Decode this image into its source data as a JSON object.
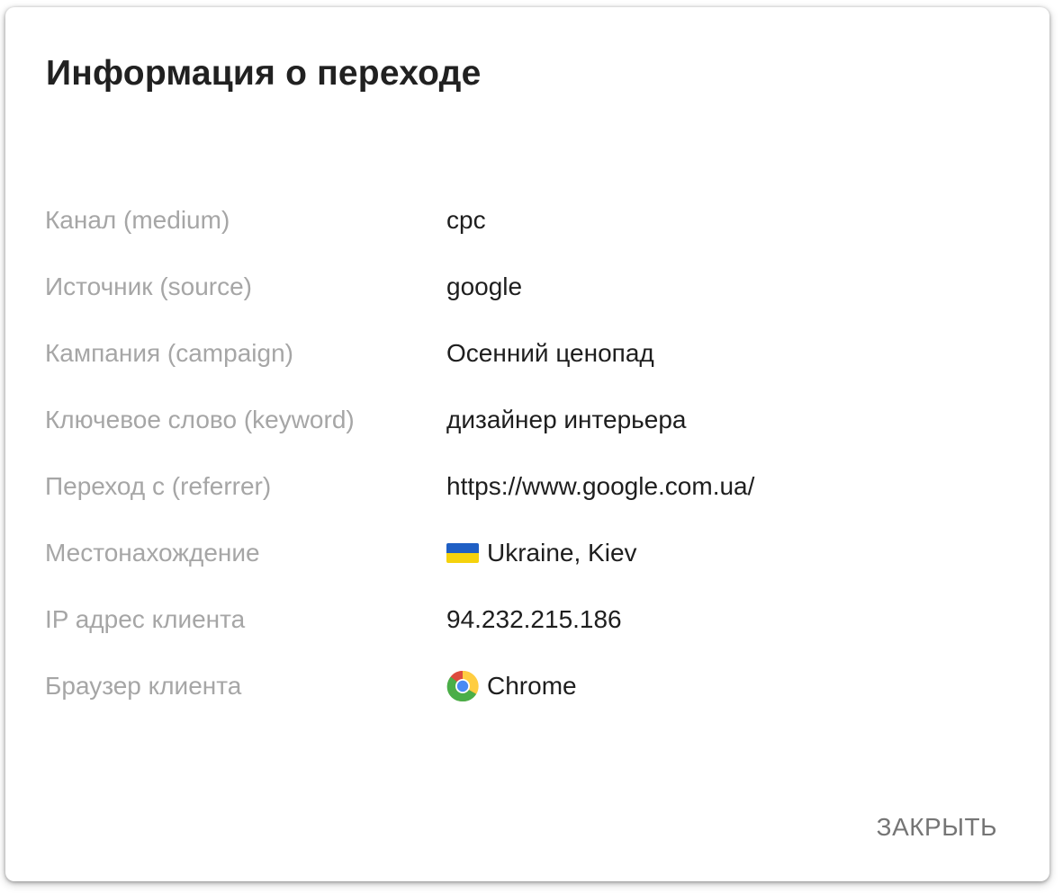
{
  "dialog": {
    "title": "Информация о переходе",
    "close_label": "ЗАКРЫТЬ"
  },
  "rows": [
    {
      "label": "Канал (medium)",
      "value": "cpc"
    },
    {
      "label": "Источник (source)",
      "value": "google"
    },
    {
      "label": "Кампания (campaign)",
      "value": "Осенний ценопад"
    },
    {
      "label": "Ключевое слово (keyword)",
      "value": "дизайнер интерьера"
    },
    {
      "label": "Переход с (referrer)",
      "value": "https://www.google.com.ua/"
    },
    {
      "label": "Местонахождение",
      "value": "Ukraine, Kiev",
      "icon": "ukraine-flag-icon"
    },
    {
      "label": "IP адрес клиента",
      "value": "94.232.215.186"
    },
    {
      "label": "Браузер клиента",
      "value": "Chrome",
      "icon": "chrome-icon"
    }
  ],
  "colors": {
    "label": "#a6a6a6",
    "value": "#1e1e1e",
    "title": "#212121",
    "close": "#757575",
    "flag_blue": "#1f5fc4",
    "flag_yellow": "#f5d20d"
  }
}
